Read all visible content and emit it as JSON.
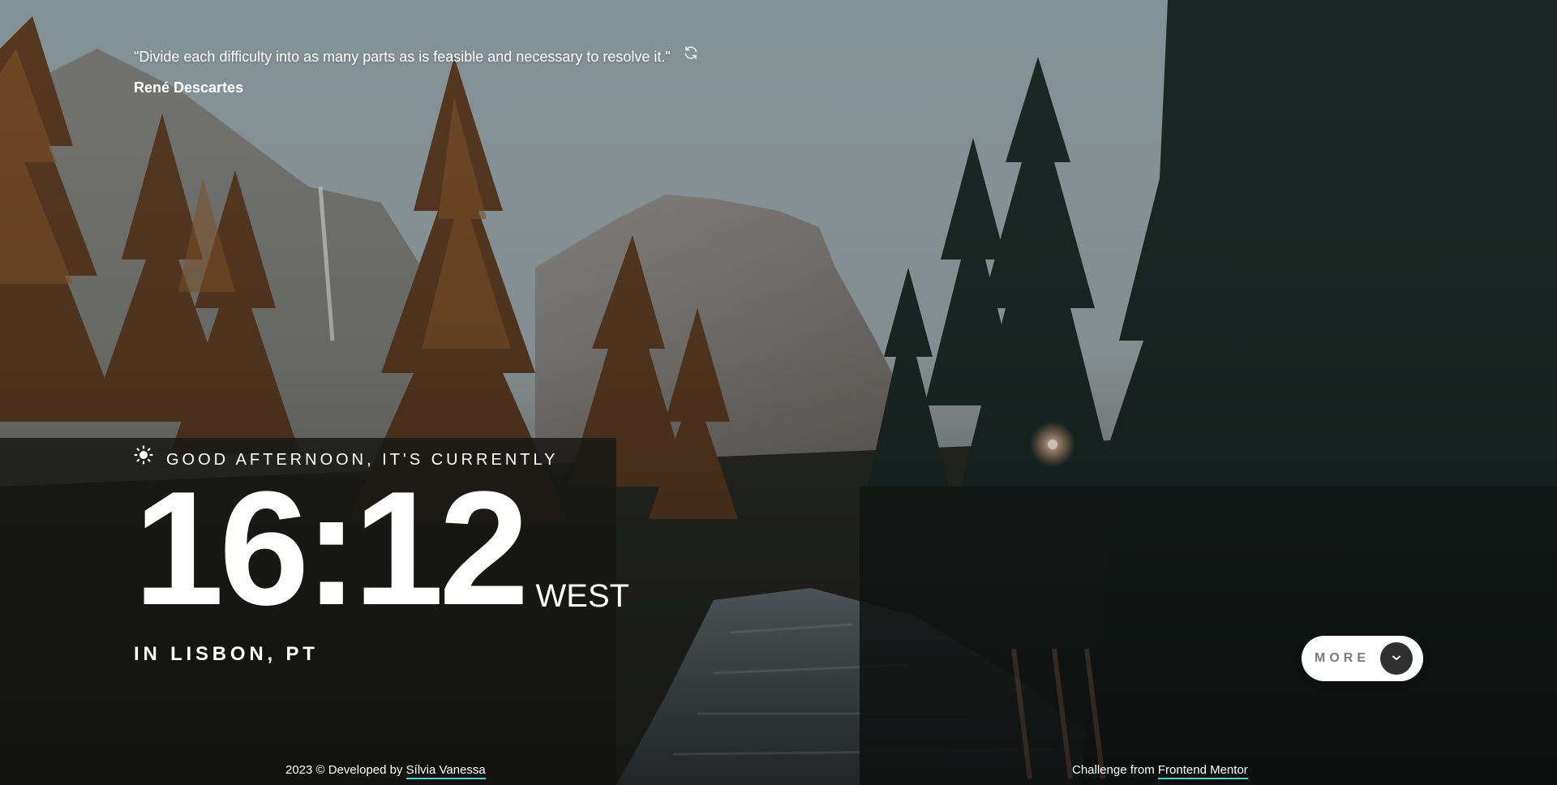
{
  "quote": {
    "text": "\"Divide each difficulty into as many parts as is feasible and necessary to resolve it.\"",
    "author": "René Descartes",
    "refresh_icon": "refresh-icon"
  },
  "clock": {
    "greeting": "GOOD AFTERNOON, IT'S CURRENTLY",
    "greeting_icon": "sun-icon",
    "time": "16:12",
    "timezone": "WEST",
    "location": "IN LISBON, PT"
  },
  "more_button": {
    "label": "MORE",
    "icon": "chevron-down-icon"
  },
  "footer": {
    "left_prefix": "2023 © Developed by ",
    "left_link": "Sílvia Vanessa",
    "right_prefix": "Challenge from ",
    "right_link": "Frontend Mentor"
  },
  "colors": {
    "accent_underline": "#4cd2c6",
    "more_button_bg": "#ffffff",
    "more_circle_bg": "#303030",
    "more_label": "#7a7a80"
  }
}
